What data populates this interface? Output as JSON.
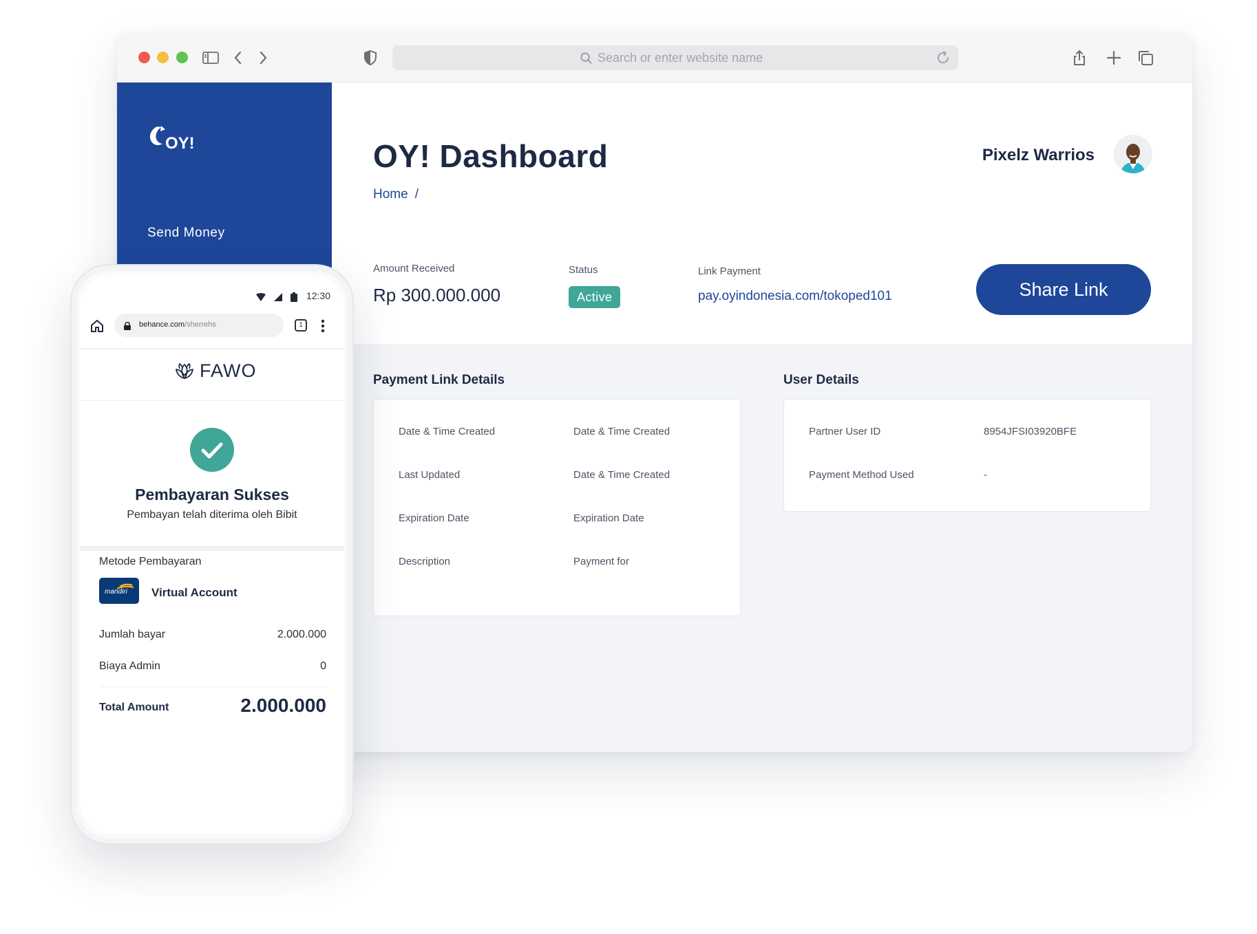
{
  "browser": {
    "url_placeholder": "Search or enter website name"
  },
  "sidebar": {
    "logo_text": "OY!",
    "items": [
      {
        "label": "Send Money"
      }
    ]
  },
  "header": {
    "title": "OY! Dashboard",
    "breadcrumb": {
      "home": "Home",
      "separator": "/"
    },
    "user_name": "Pixelz Warrios"
  },
  "summary": {
    "amount_label": "Amount Received",
    "amount_value": "Rp 300.000.000",
    "status_label": "Status",
    "status_value": "Active",
    "link_label": "Link Payment",
    "link_value": "pay.oyindonesia.com/tokoped101",
    "share_button": "Share Link"
  },
  "payment_link_details": {
    "title": "Payment Link Details",
    "rows": [
      {
        "label": "Date & Time Created",
        "value": "Date & Time Created"
      },
      {
        "label": "Last Updated",
        "value": "Date & Time Created"
      },
      {
        "label": "Expiration Date",
        "value": "Expiration Date"
      },
      {
        "label": "Description",
        "value": "Payment for"
      }
    ]
  },
  "user_details": {
    "title": "User Details",
    "rows": [
      {
        "label": "Partner User ID",
        "value": "8954JFSI03920BFE"
      },
      {
        "label": "Payment Method Used",
        "value": "-"
      }
    ]
  },
  "phone": {
    "time": "12:30",
    "url_domain": "behance.com",
    "url_path": "/sherrehs",
    "tab_count": "1",
    "brand": "FAWO",
    "success_title": "Pembayaran Sukses",
    "success_sub": "Pembayan telah diterima oleh Bibit",
    "method_label": "Metode Pembayaran",
    "bank_name": "mandiri",
    "method_value": "Virtual Account",
    "rows": [
      {
        "label": "Jumlah bayar",
        "value": "2.000.000"
      },
      {
        "label": "Biaya Admin",
        "value": "0"
      }
    ],
    "total_label": "Total Amount",
    "total_value": "2.000.000"
  },
  "colors": {
    "brand_blue": "#1e4699",
    "status_green": "#3fa698",
    "title_navy": "#1e2a44"
  }
}
